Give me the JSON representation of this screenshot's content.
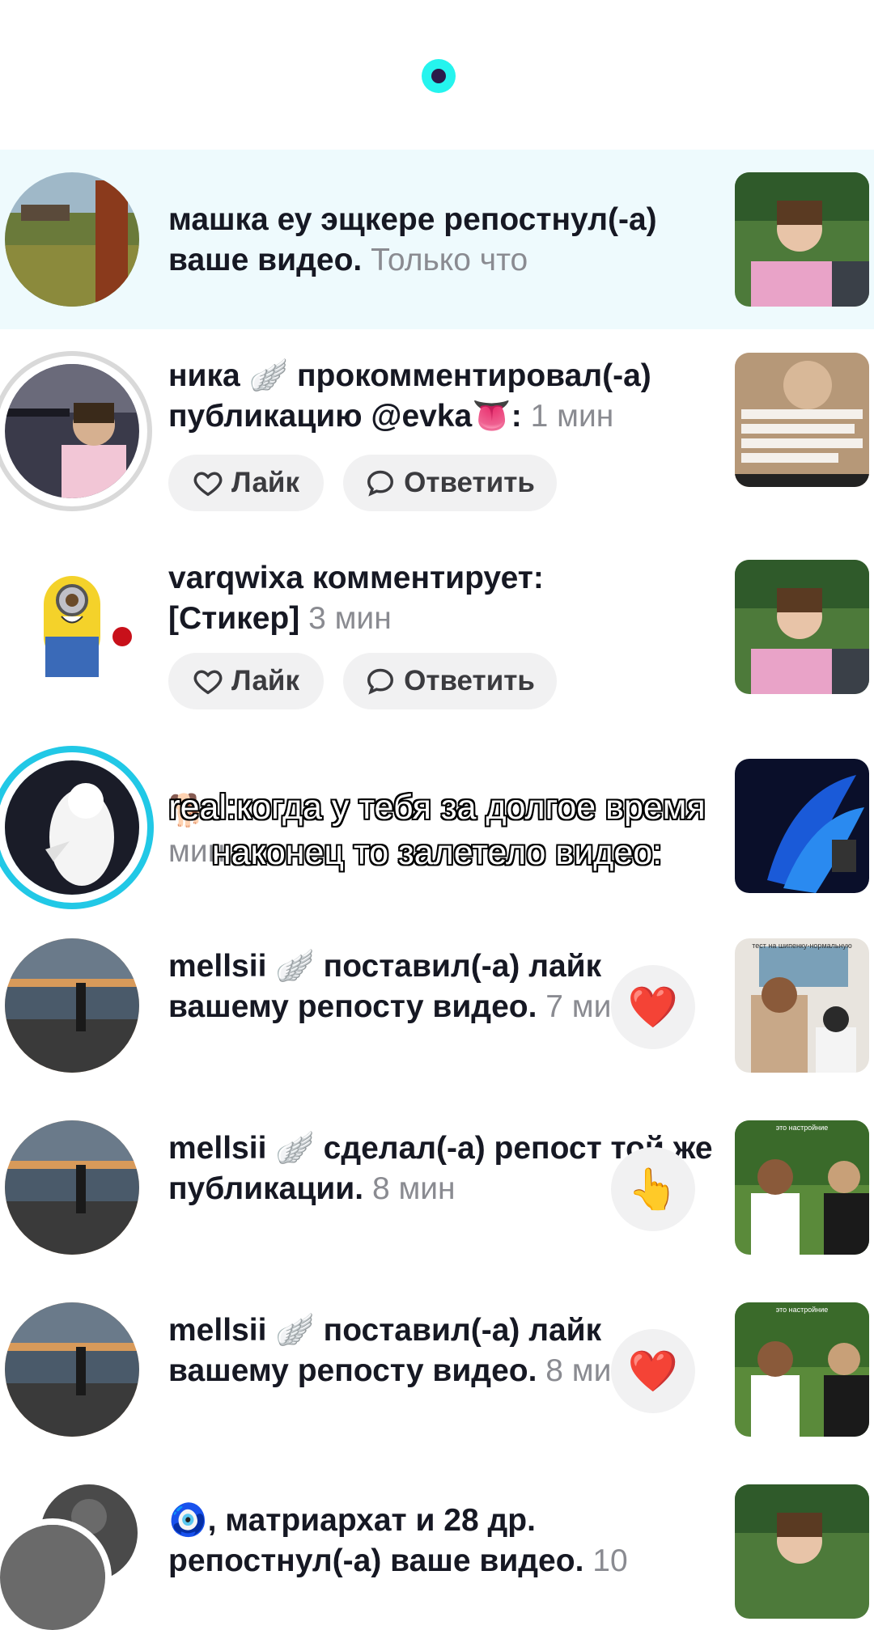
{
  "notifications": [
    {
      "user": "машка еу эщкере",
      "action": "репостнул(-а) ваше видео.",
      "time": "Только что"
    },
    {
      "user": "ника",
      "badge": "🪽",
      "action": "прокомментировал(-а) публикацию @evka",
      "badge2": "👅",
      "suffix": ":",
      "time": "1 мин",
      "like_label": "Лайк",
      "reply_label": "Ответить"
    },
    {
      "user": "varqwixa",
      "action": "комментирует:",
      "comment": "[Стикер]",
      "time": "3 мин",
      "like_label": "Лайк",
      "reply_label": "Ответить"
    },
    {
      "user_icon": "🐕",
      "partial": "мин"
    },
    {
      "user": "mellsii",
      "badge": "🪽",
      "action": "поставил(-а) лайк вашему репосту видео.",
      "time": "7 мин",
      "action_icon": "❤️"
    },
    {
      "user": "mellsii",
      "badge": "🪽",
      "action": "сделал(-а) репост той же публикации.",
      "time": "8 мин",
      "action_icon": "👆"
    },
    {
      "user": "mellsii",
      "badge": "🪽",
      "action": "поставил(-а) лайк вашему репосту видео.",
      "time": "8 мин",
      "action_icon": "❤️"
    },
    {
      "prefix_icon": "🧿",
      "user": ", матриархат и 28 др.",
      "action": "репостнул(-а) ваше видео.",
      "time": "10"
    }
  ],
  "caption": "real:когда у тебя за долгое время наконец то залетело видео:",
  "thumb_texts": {
    "t5": "тест на шипенку-нормальную",
    "t6": "это настройние",
    "t7": "это настройние"
  },
  "colors": {
    "accent": "#25f4ee",
    "highlight": "#eefafd",
    "time": "#8a8b91"
  }
}
